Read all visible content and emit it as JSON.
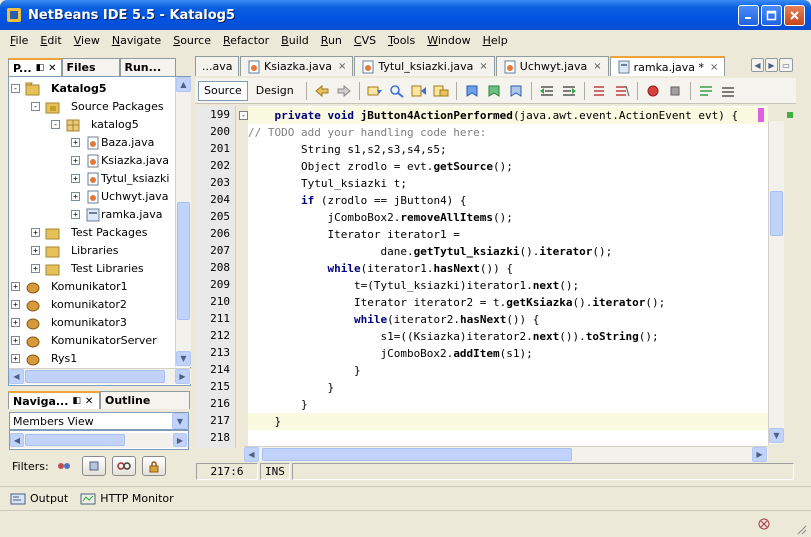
{
  "window": {
    "title": "NetBeans IDE 5.5 - Katalog5"
  },
  "menu": [
    "File",
    "Edit",
    "View",
    "Navigate",
    "Source",
    "Refactor",
    "Build",
    "Run",
    "CVS",
    "Tools",
    "Window",
    "Help"
  ],
  "left_tabs": {
    "projects": "P...",
    "files": "Files",
    "runtime": "Run..."
  },
  "tree": [
    {
      "label": "Katalog5"
    },
    {
      "label": "Source Packages"
    },
    {
      "label": "katalog5"
    },
    {
      "label": "Baza.java"
    },
    {
      "label": "Ksiazka.java"
    },
    {
      "label": "Tytul_ksiazki"
    },
    {
      "label": "Uchwyt.java"
    },
    {
      "label": "ramka.java"
    },
    {
      "label": "Test Packages"
    },
    {
      "label": "Libraries"
    },
    {
      "label": "Test Libraries"
    },
    {
      "label": "Komunikator1"
    },
    {
      "label": "komunikator2"
    },
    {
      "label": "komunikator3"
    },
    {
      "label": "KomunikatorServer"
    },
    {
      "label": "Rys1"
    }
  ],
  "navigator": {
    "tab": "Naviga...",
    "tab2": "Outline",
    "select": "Members View",
    "filters_label": "Filters:"
  },
  "editor_tabs": [
    {
      "label": "...ava"
    },
    {
      "label": "Ksiazka.java"
    },
    {
      "label": "Tytul_ksiazki.java"
    },
    {
      "label": "Uchwyt.java"
    },
    {
      "label": "ramka.java *"
    }
  ],
  "editor_tab_close": "×",
  "editor_modes": {
    "source": "Source",
    "design": "Design"
  },
  "line_numbers": [
    "199",
    "200",
    "201",
    "202",
    "203",
    "204",
    "205",
    "206",
    "207",
    "208",
    "209",
    "210",
    "211",
    "212",
    "213",
    "214",
    "215",
    "216",
    "217",
    "218"
  ],
  "code": {
    "l199_a": "    ",
    "l199_kw": "private void",
    "l199_m": " jButton4ActionPerformed",
    "l199_b": "(java.awt.event.ActionEvent evt) {",
    "l200": "// TODO add your handling code here:",
    "l201": "        String s1,s2,s3,s4,s5;",
    "l202_a": "        Object zrodlo = evt.",
    "l202_m": "getSource",
    "l202_b": "();",
    "l203": "        Tytul_ksiazki t;",
    "l204_a": "        ",
    "l204_kw": "if",
    "l204_b": " (zrodlo == jButton4) {",
    "l205_a": "            jComboBox2.",
    "l205_m": "removeAllItems",
    "l205_b": "();",
    "l206": "            Iterator iterator1 =",
    "l207_a": "                    dane.",
    "l207_m": "getTytul_ksiazki",
    "l207_b": "().",
    "l207_m2": "iterator",
    "l207_c": "();",
    "l208_a": "            ",
    "l208_kw": "while",
    "l208_b": "(iterator1.",
    "l208_m": "hasNext",
    "l208_c": "()) {",
    "l209_a": "                t=(Tytul_ksiazki)iterator1.",
    "l209_m": "next",
    "l209_b": "();",
    "l210_a": "                Iterator iterator2 = t.",
    "l210_m": "getKsiazka",
    "l210_b": "().",
    "l210_m2": "iterator",
    "l210_c": "();",
    "l211_a": "                ",
    "l211_kw": "while",
    "l211_b": "(iterator2.",
    "l211_m": "hasNext",
    "l211_c": "()) {",
    "l212_a": "                    s1=((Ksiazka)iterator2.",
    "l212_m": "next",
    "l212_b": "()).",
    "l212_m2": "toString",
    "l212_c": "();",
    "l213_a": "                    jComboBox2.",
    "l213_m": "addItem",
    "l213_b": "(s1);",
    "l214": "                }",
    "l215": "            }",
    "l216": "        }",
    "l217": "    }",
    "l218": ""
  },
  "status": {
    "position": "217:6",
    "mode": "INS"
  },
  "bottom_tabs": {
    "output": "Output",
    "http": "HTTP Monitor"
  }
}
